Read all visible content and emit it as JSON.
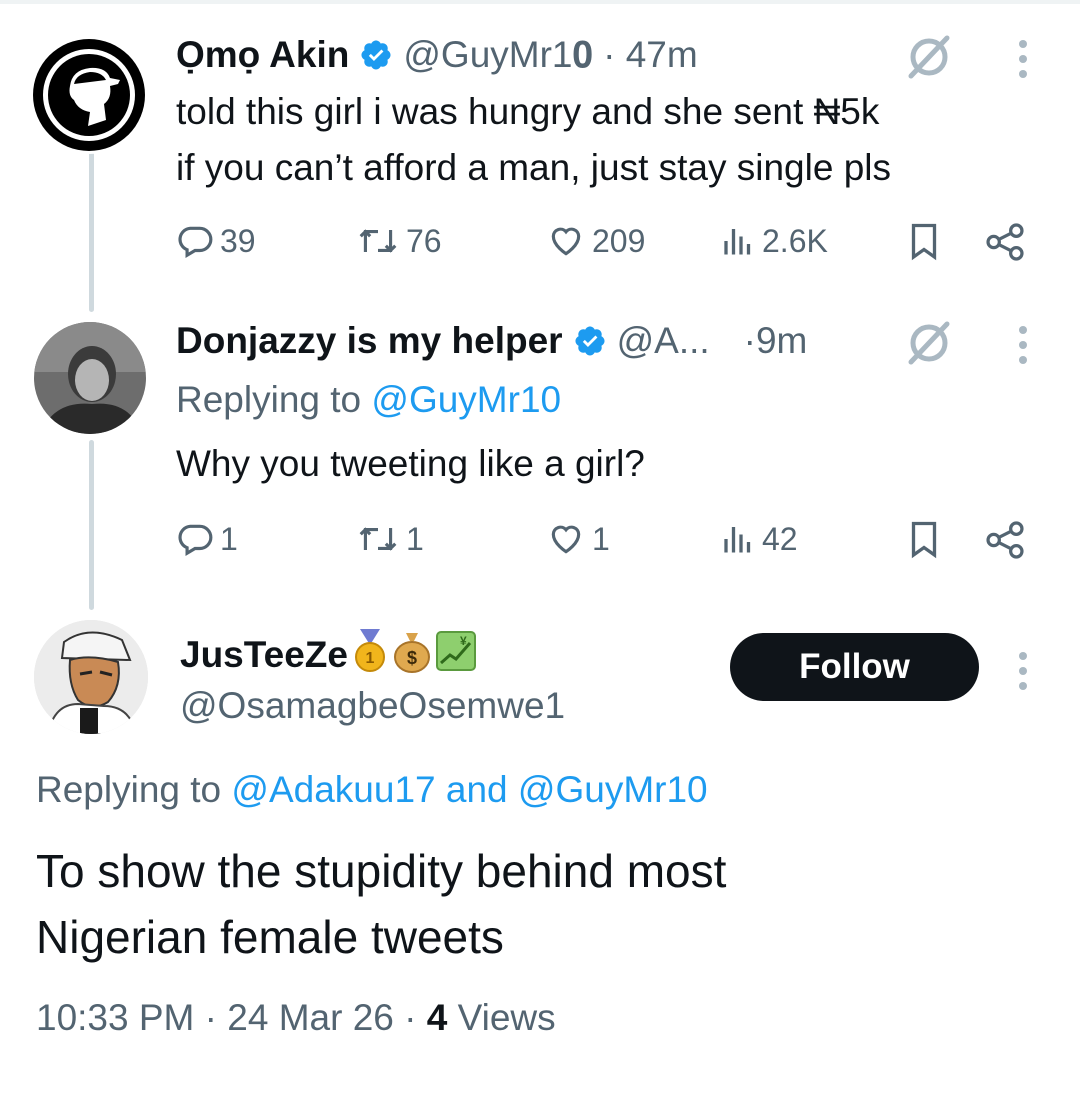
{
  "tweet1": {
    "name": "Ọmọ Akin",
    "handle": "@GuyMr1𝟎",
    "time": "· 47m",
    "line1": "told this girl i was hungry and she sent ₦5k",
    "line2": "if you can’t afford a man, just stay single pls",
    "replies": "39",
    "reposts": "76",
    "likes": "209",
    "views": "2.6K"
  },
  "tweet2": {
    "name": "Donjazzy is my helper",
    "handle": "@A...",
    "time": "·9m",
    "replying_prefix": "Replying to",
    "replying_to": "@GuyMr10",
    "text": "Why you tweeting like a girl?",
    "replies": "1",
    "reposts": "1",
    "likes": "1",
    "views": "42"
  },
  "main": {
    "name": "JusTeeZe",
    "handle": "@OsamagbeOsemwe1",
    "follow_label": "Follow",
    "replying_prefix": "Replying to",
    "replying_to_1": "@Adakuu17",
    "replying_and": "and",
    "replying_to_2": "@GuyMr10",
    "text_line1": "To show the stupidity behind most",
    "text_line2": "Nigerian female tweets",
    "time": "10:33 PM",
    "date": "· 24 Mar 26 ·",
    "views_count": "4",
    "views_label": "Views"
  },
  "colors": {
    "link": "#1d9bf0",
    "muted": "#536471",
    "verified": "#1d9bf0",
    "button": "#0f1419"
  },
  "icons": [
    "reply-icon",
    "repost-icon",
    "like-icon",
    "views-icon",
    "bookmark-icon",
    "share-icon",
    "grok-icon",
    "more-icon",
    "verified-badge-icon"
  ]
}
